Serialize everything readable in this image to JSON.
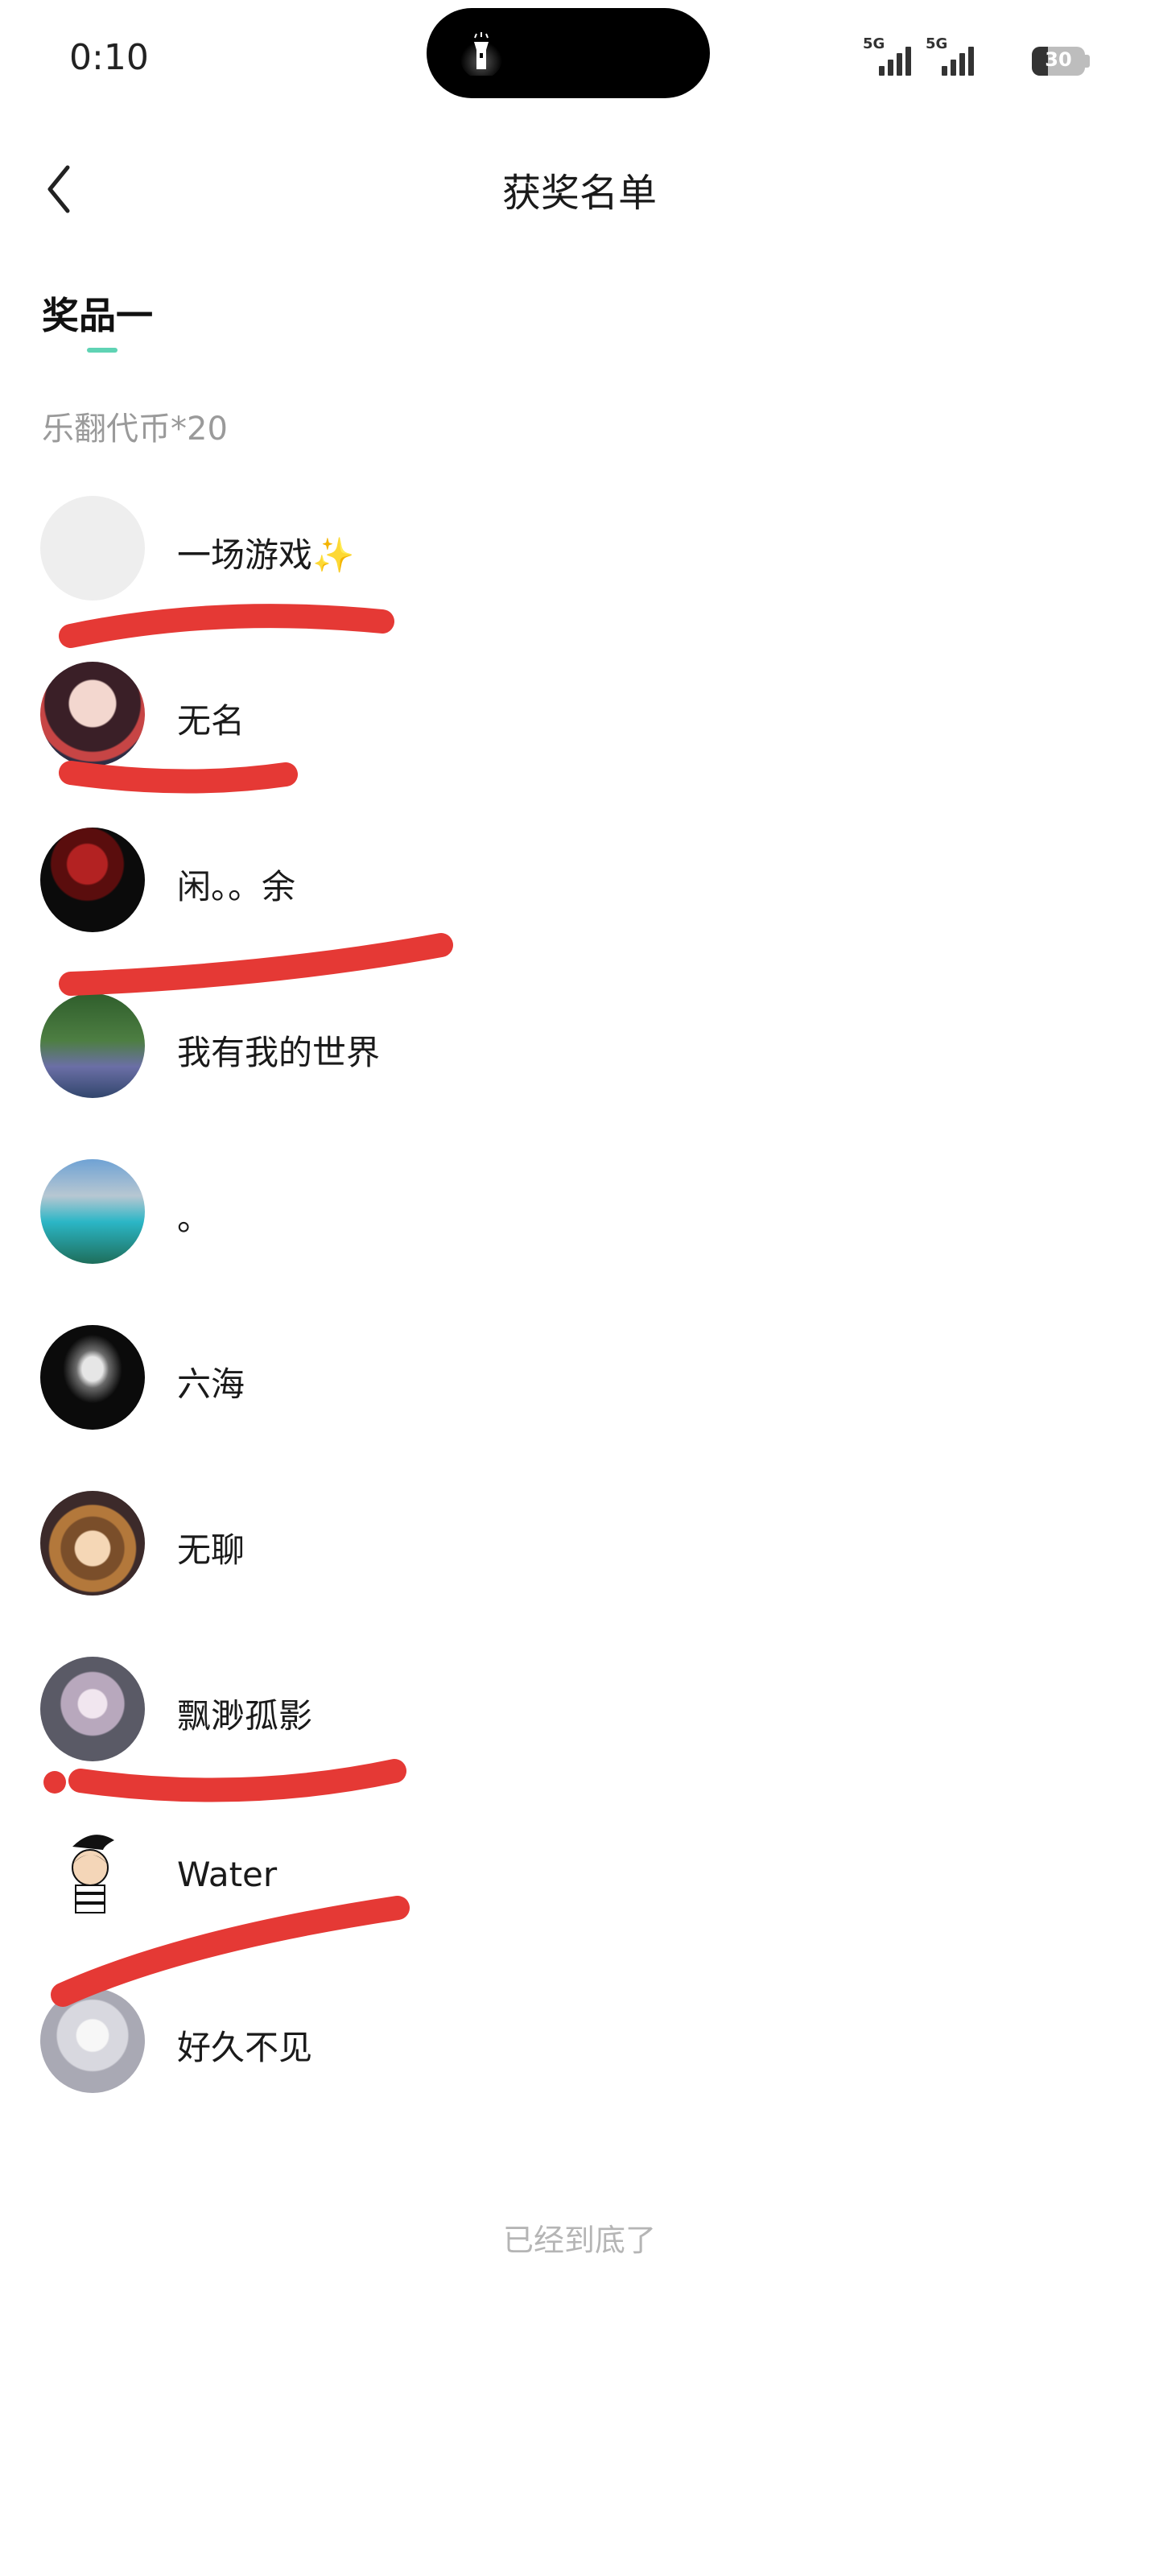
{
  "status_bar": {
    "time": "0:10",
    "signal_1": "5G",
    "signal_2": "5G",
    "battery": "30",
    "battery_level_percent": 30,
    "island_icon": "flashlight-icon"
  },
  "header": {
    "title": "获奖名单",
    "back_icon": "back-arrow-icon"
  },
  "tab": {
    "label": "奖品一",
    "indicator_color": "#5fd3b4"
  },
  "prize": {
    "description": "乐翻代币*20"
  },
  "winners": [
    {
      "name": "一场游戏✨"
    },
    {
      "name": "无名"
    },
    {
      "name": "闲。。余"
    },
    {
      "name": "我有我的世界"
    },
    {
      "name": "。"
    },
    {
      "name": "六海"
    },
    {
      "name": "无聊"
    },
    {
      "name": "飘渺孤影"
    },
    {
      "name": "Water"
    },
    {
      "name": "好久不见"
    }
  ],
  "footer": {
    "text": "已经到底了"
  },
  "colors": {
    "redaction_marker": "#e53935",
    "secondary_text": "#9a9a9a"
  }
}
